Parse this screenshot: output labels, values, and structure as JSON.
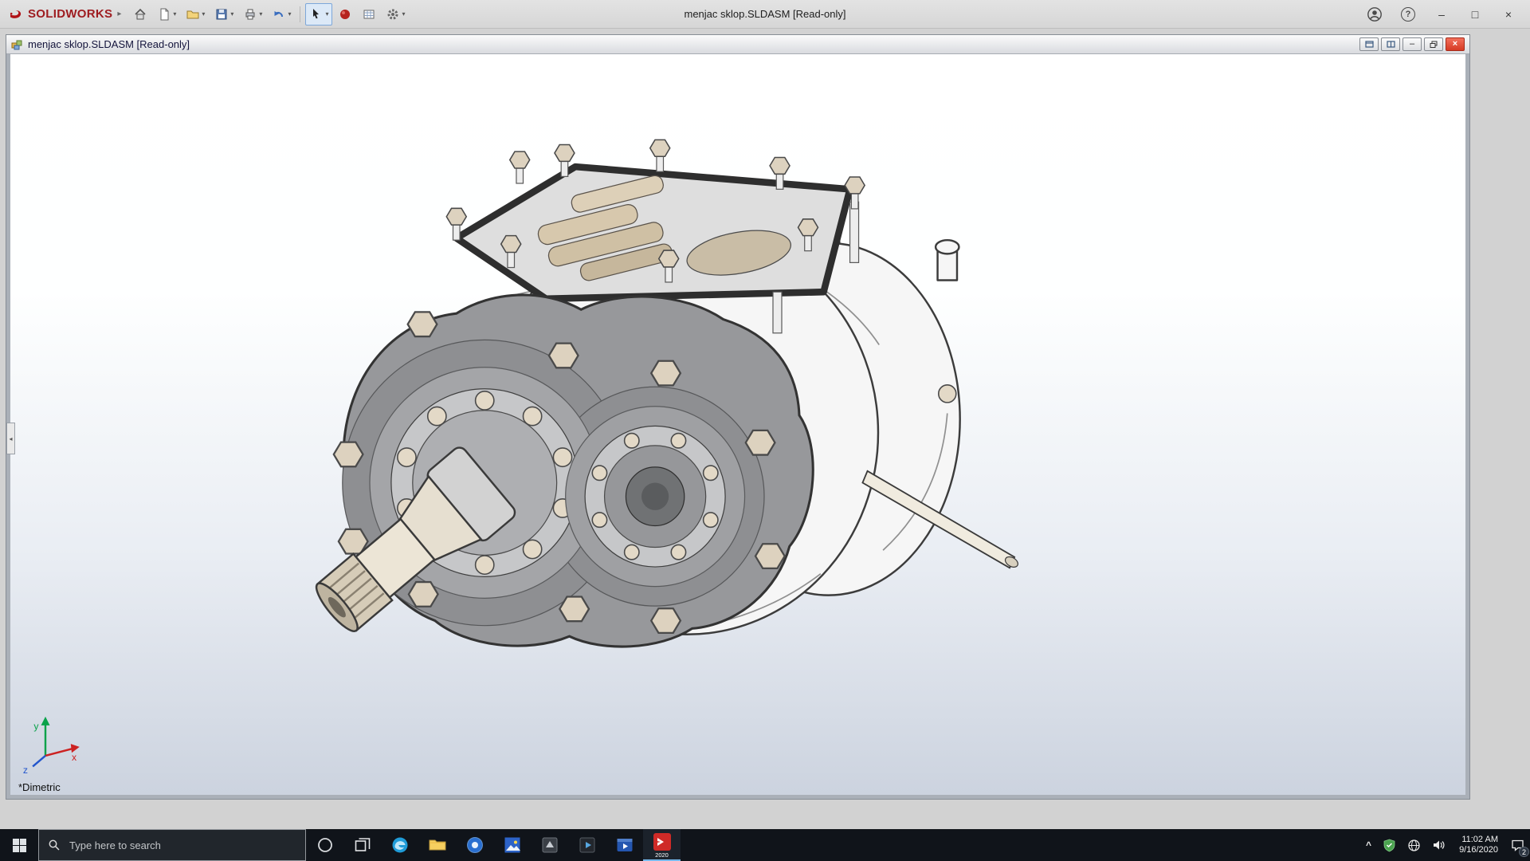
{
  "titlebar": {
    "brand": "SOLIDWORKS",
    "title": "menjac sklop.SLDASM [Read-only]"
  },
  "icons": {
    "caret": "▾",
    "flyout_arrow": "▸",
    "minimize": "–",
    "maximize": "□",
    "close": "×",
    "help": "?",
    "tray_chevron": "^",
    "panel_collapse": "◂"
  },
  "document": {
    "title": "menjac sklop.SLDASM [Read-only]",
    "view_label": "*Dimetric"
  },
  "triad": {
    "x": "x",
    "y": "y",
    "z": "z"
  },
  "taskbar": {
    "search_placeholder": "Type here to search",
    "sw_badge": "2020",
    "time": "11:02 AM",
    "date": "9/16/2020",
    "notification_count": "2"
  },
  "colors": {
    "brand_red": "#9e1c20",
    "taskbar_bg": "#10141a",
    "doc_close_red": "#d63a24",
    "viewport_bottom": "#ccd3df"
  }
}
